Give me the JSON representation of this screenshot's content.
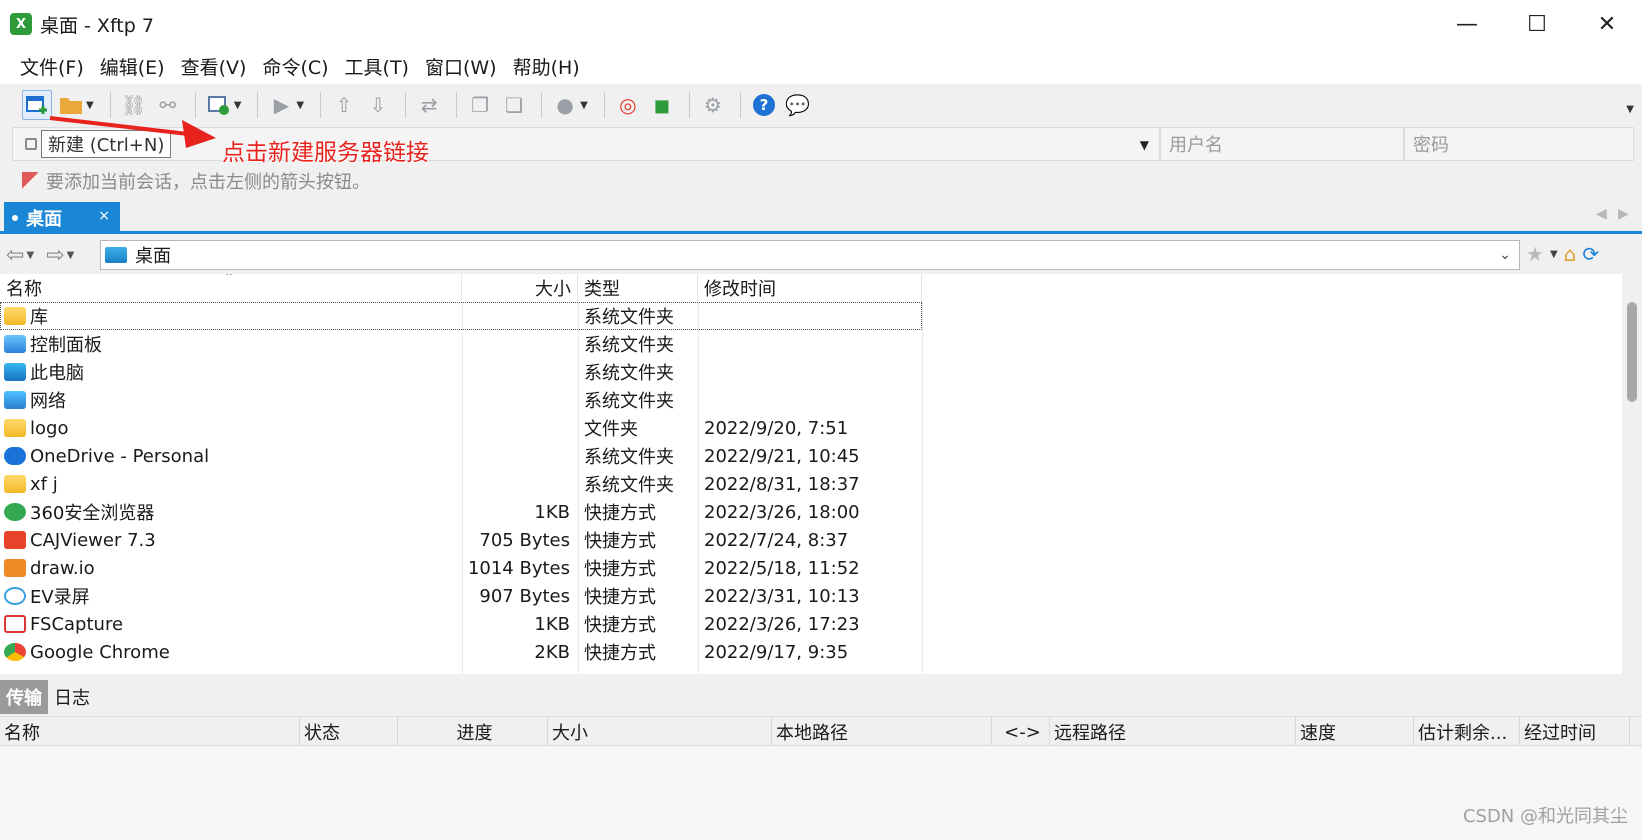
{
  "window": {
    "title": "桌面 - Xftp 7",
    "app_icon_label": "X",
    "minimize": "—",
    "maximize": "☐",
    "close": "✕"
  },
  "menu": [
    "文件(F)",
    "编辑(E)",
    "查看(V)",
    "命令(C)",
    "工具(T)",
    "窗口(W)",
    "帮助(H)"
  ],
  "address": {
    "tooltip": "新建 (Ctrl+N)",
    "username_placeholder": "用户名",
    "password_placeholder": "密码"
  },
  "annotation": {
    "text": "点击新建服务器链接",
    "color": "#e8231e"
  },
  "hint": "要添加当前会话，点击左侧的箭头按钮。",
  "tab": {
    "label": "桌面",
    "close": "×"
  },
  "path": {
    "value": "桌面"
  },
  "files": {
    "columns": [
      "名称",
      "大小",
      "类型",
      "修改时间"
    ],
    "rows": [
      {
        "icon": "library-folder-icon",
        "name": "库",
        "size": "",
        "type": "系统文件夹",
        "time": ""
      },
      {
        "icon": "control-panel-icon",
        "name": "控制面板",
        "size": "",
        "type": "系统文件夹",
        "time": ""
      },
      {
        "icon": "this-pc-icon",
        "name": "此电脑",
        "size": "",
        "type": "系统文件夹",
        "time": ""
      },
      {
        "icon": "network-icon",
        "name": "网络",
        "size": "",
        "type": "系统文件夹",
        "time": ""
      },
      {
        "icon": "folder-icon",
        "name": "logo",
        "size": "",
        "type": "文件夹",
        "time": "2022/9/20, 7:51"
      },
      {
        "icon": "onedrive-icon",
        "name": "OneDrive - Personal",
        "size": "",
        "type": "系统文件夹",
        "time": "2022/9/21, 10:45"
      },
      {
        "icon": "folder-icon",
        "name": "xf j",
        "size": "",
        "type": "系统文件夹",
        "time": "2022/8/31, 18:37"
      },
      {
        "icon": "browser-360-icon",
        "name": "360安全浏览器",
        "size": "1KB",
        "type": "快捷方式",
        "time": "2022/3/26, 18:00"
      },
      {
        "icon": "cajviewer-icon",
        "name": "CAJViewer 7.3",
        "size": "705 Bytes",
        "type": "快捷方式",
        "time": "2022/7/24, 8:37"
      },
      {
        "icon": "drawio-icon",
        "name": "draw.io",
        "size": "1014 Bytes",
        "type": "快捷方式",
        "time": "2022/5/18, 11:52"
      },
      {
        "icon": "ev-recorder-icon",
        "name": "EV录屏",
        "size": "907 Bytes",
        "type": "快捷方式",
        "time": "2022/3/31, 10:13"
      },
      {
        "icon": "fscapture-icon",
        "name": "FSCapture",
        "size": "1KB",
        "type": "快捷方式",
        "time": "2022/3/26, 17:23"
      },
      {
        "icon": "chrome-icon",
        "name": "Google Chrome",
        "size": "2KB",
        "type": "快捷方式",
        "time": "2022/9/17, 9:35"
      }
    ]
  },
  "bottom": {
    "tabs": [
      "传输",
      "日志"
    ],
    "columns": [
      "名称",
      "状态",
      "进度",
      "大小",
      "本地路径",
      "<->",
      "远程路径",
      "速度",
      "估计剩余...",
      "经过时间"
    ]
  },
  "watermark": "CSDN @和光同其尘"
}
